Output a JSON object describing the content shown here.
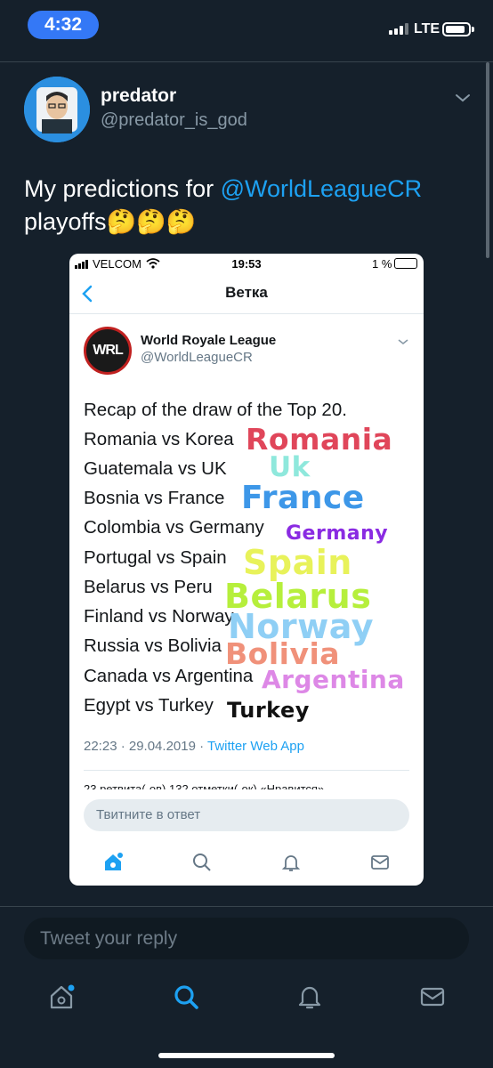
{
  "status_bar": {
    "time": "4:32",
    "network": "LTE"
  },
  "tweet": {
    "author_name": "predator",
    "author_handle": "@predator_is_god",
    "text_prefix": "My predictions for ",
    "mention": "@WorldLeagueCR",
    "text_line2": "playoffs🤔🤔🤔"
  },
  "embedded_screenshot": {
    "carrier": "VELCOM",
    "clock": "19:53",
    "battery": "1 %",
    "nav_title": "Ветка",
    "account_logo": "WRL",
    "account_name": "World Royale League",
    "account_handle": "@WorldLeagueCR",
    "heading": "Recap of the draw of the Top 20.",
    "matches": [
      "Romania vs Korea",
      "Guatemala vs UK",
      "Bosnia vs France",
      "Colombia vs Germany",
      "Portugal vs Spain",
      "Belarus vs Peru",
      "Finland vs Norway",
      "Russia vs Bolivia",
      "Canada vs Argentina",
      "Egypt vs Turkey"
    ],
    "predictions": [
      {
        "text": "Romania",
        "color": "#e0465a"
      },
      {
        "text": "Uk",
        "color": "#8fe8dc"
      },
      {
        "text": "France",
        "color": "#3d97e8"
      },
      {
        "text": "Germany",
        "color": "#8a2be2"
      },
      {
        "text": "Spain",
        "color": "#e8f25a"
      },
      {
        "text": "Belarus",
        "color": "#b6ef3c"
      },
      {
        "text": "Norway",
        "color": "#8fcff5"
      },
      {
        "text": "Bolivia",
        "color": "#f0917a"
      },
      {
        "text": "Argentina",
        "color": "#dd88e6"
      },
      {
        "text": "Turkey",
        "color": "#111111"
      }
    ],
    "meta_time": "22:23 · 29.04.2019 · ",
    "meta_app": "Twitter Web App",
    "stats": "23 ретвита(-ов)   132 отметки(-ок) «Нравится»",
    "reply_placeholder": "Твитните в ответ"
  },
  "reply_placeholder": "Tweet your reply",
  "tabs": [
    "home-icon",
    "search-icon",
    "notifications-icon",
    "messages-icon"
  ],
  "colors": {
    "background": "#15202b",
    "accent": "#1da1f2",
    "time_pill": "#3478f6"
  }
}
